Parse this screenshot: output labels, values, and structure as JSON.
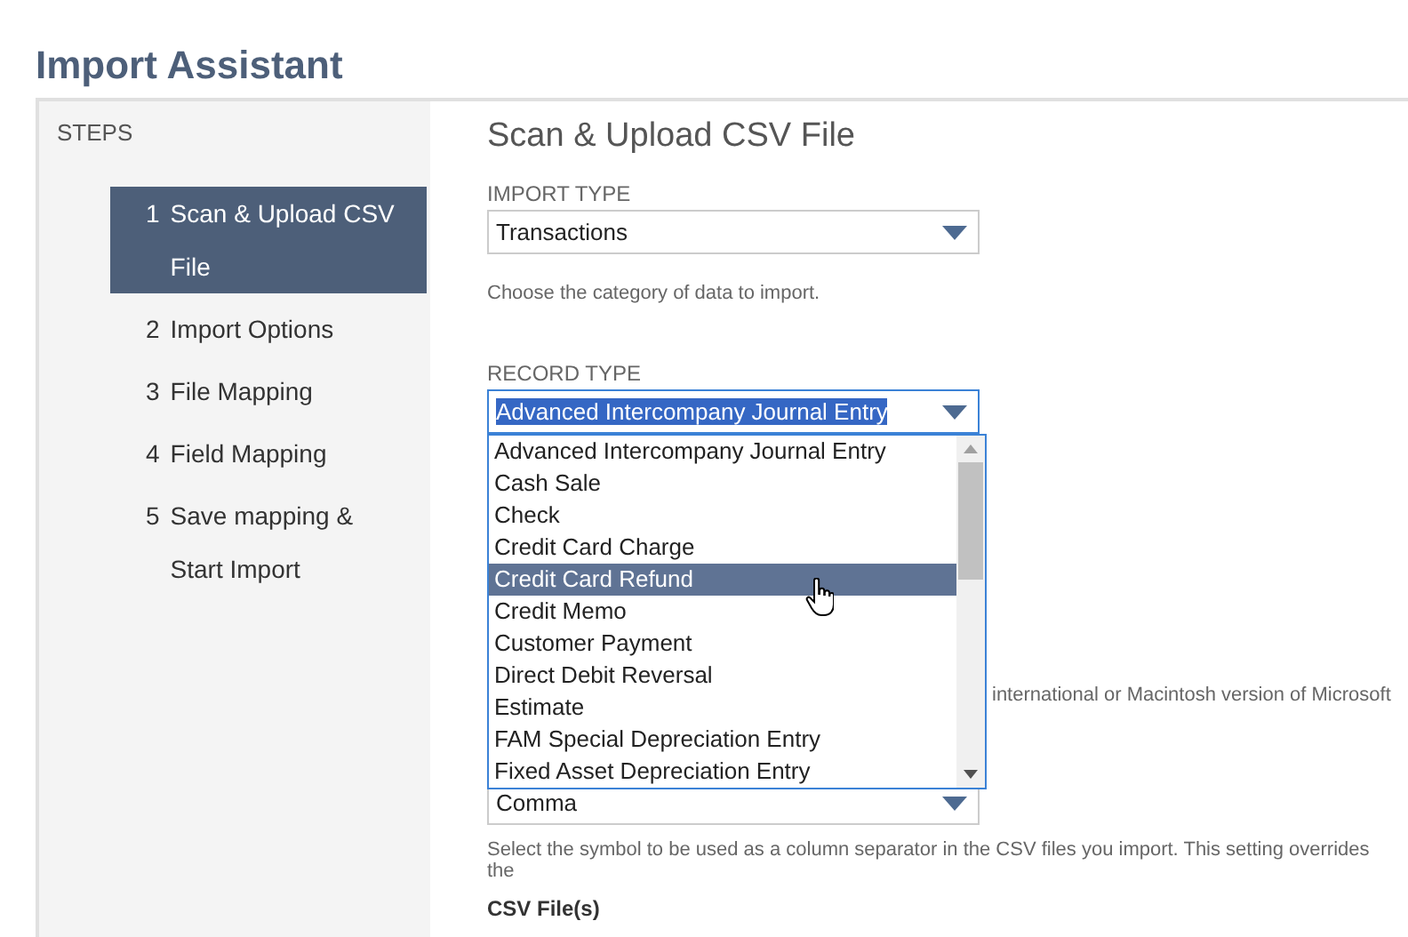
{
  "page_title": "Import Assistant",
  "sidebar": {
    "heading": "STEPS",
    "steps": [
      {
        "number": "1",
        "label": "Scan & Upload CSV File",
        "selected": true
      },
      {
        "number": "2",
        "label": "Import Options",
        "selected": false
      },
      {
        "number": "3",
        "label": "File Mapping",
        "selected": false
      },
      {
        "number": "4",
        "label": "Field Mapping",
        "selected": false
      },
      {
        "number": "5",
        "label": "Save mapping & Start Import",
        "selected": false
      }
    ]
  },
  "section_title": "Scan & Upload CSV File",
  "import_type": {
    "label": "IMPORT TYPE",
    "value": "Transactions",
    "help": "Choose the category of data to import."
  },
  "record_type": {
    "label": "RECORD TYPE",
    "value": "Advanced Intercompany Journal Entry",
    "focused": true,
    "options": [
      {
        "label": "Advanced Intercompany Journal Entry",
        "highlighted": false
      },
      {
        "label": "Cash Sale",
        "highlighted": false
      },
      {
        "label": "Check",
        "highlighted": false
      },
      {
        "label": "Credit Card Charge",
        "highlighted": false
      },
      {
        "label": "Credit Card Refund",
        "highlighted": true
      },
      {
        "label": "Credit Memo",
        "highlighted": false
      },
      {
        "label": "Customer Payment",
        "highlighted": false
      },
      {
        "label": "Direct Debit Reversal",
        "highlighted": false
      },
      {
        "label": "Estimate",
        "highlighted": false
      },
      {
        "label": "FAM Special Depreciation Entry",
        "highlighted": false
      },
      {
        "label": "Fixed Asset Depreciation Entry",
        "highlighted": false
      }
    ]
  },
  "encoding_help": "international or Macintosh version of Microsoft",
  "delimiter": {
    "value": "Comma",
    "help": "Select the symbol to be used as a column separator in the CSV files you import. This setting overrides the"
  },
  "files_label": "CSV File(s)"
}
